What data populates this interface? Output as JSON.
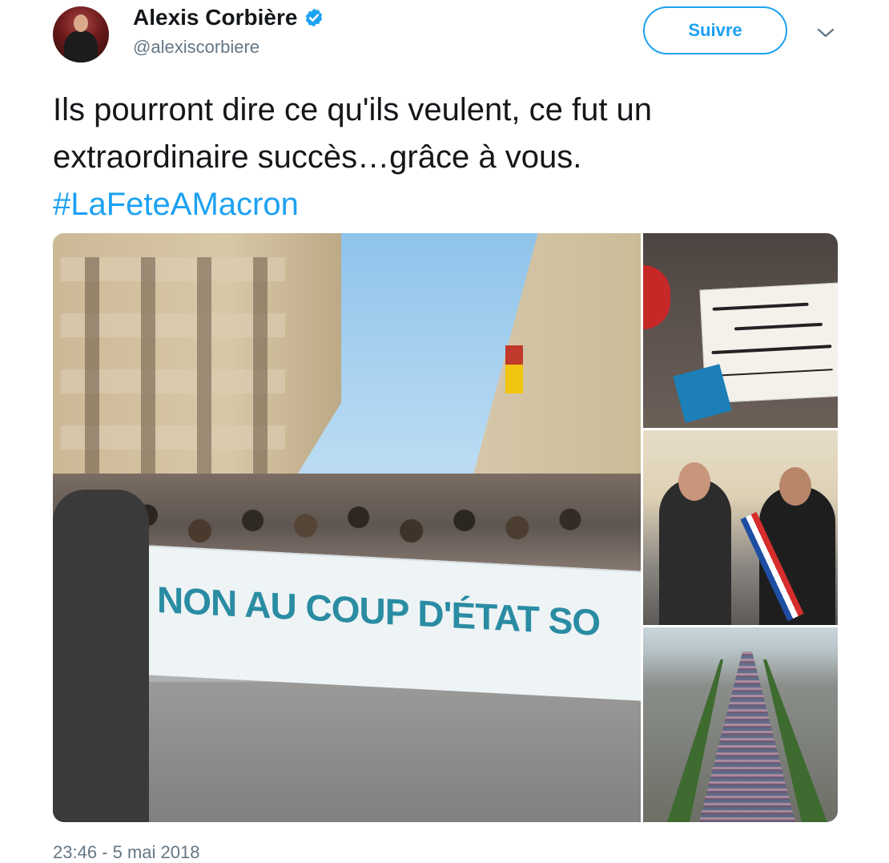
{
  "author": {
    "name": "Alexis Corbière",
    "handle": "@alexiscorbiere",
    "verified": true
  },
  "actions": {
    "follow_label": "Suivre",
    "more_icon": "chevron-down-icon"
  },
  "tweet": {
    "text_lines": [
      "Ils pourront dire ce qu'ils veulent, ce fut un",
      "extraordinaire succès…grâce à vous."
    ],
    "hashtag": "#LaFeteAMacron",
    "timestamp": "23:46 - 5 mai 2018"
  },
  "media": {
    "main_banner_text": "NON AU COUP D'ÉTAT SO"
  },
  "colors": {
    "accent": "#1da1f2",
    "text": "#14171a",
    "muted": "#657786"
  }
}
